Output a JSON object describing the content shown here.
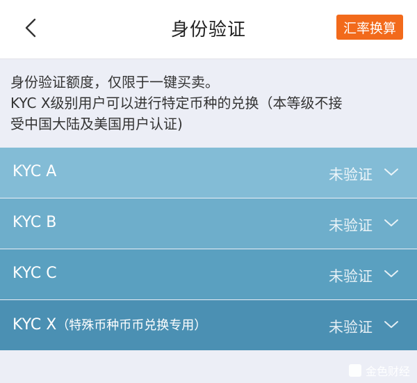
{
  "header": {
    "title": "身份验证",
    "rate_button": "汇率换算"
  },
  "notice": {
    "line1": "身份验证额度，仅限于一键买卖。",
    "line2": "KYC X级别用户可以进行特定币种的兑换（本等级不接",
    "line3": "受中国大陆及美国用户认证)"
  },
  "kyc_levels": [
    {
      "label": "KYC A",
      "note": "",
      "status": "未验证",
      "color": "#83bcd6"
    },
    {
      "label": "KYC B",
      "note": "",
      "status": "未验证",
      "color": "#6eaecb"
    },
    {
      "label": "KYC C",
      "note": "",
      "status": "未验证",
      "color": "#5aa0c0"
    },
    {
      "label": "KYC X",
      "note": "（特殊币种币币兑换专用）",
      "status": "未验证",
      "color": "#4b90b3"
    }
  ],
  "watermark": {
    "text": "金色财经"
  },
  "icons": {
    "back": "chevron-left-icon",
    "expand": "chevron-down-icon"
  }
}
